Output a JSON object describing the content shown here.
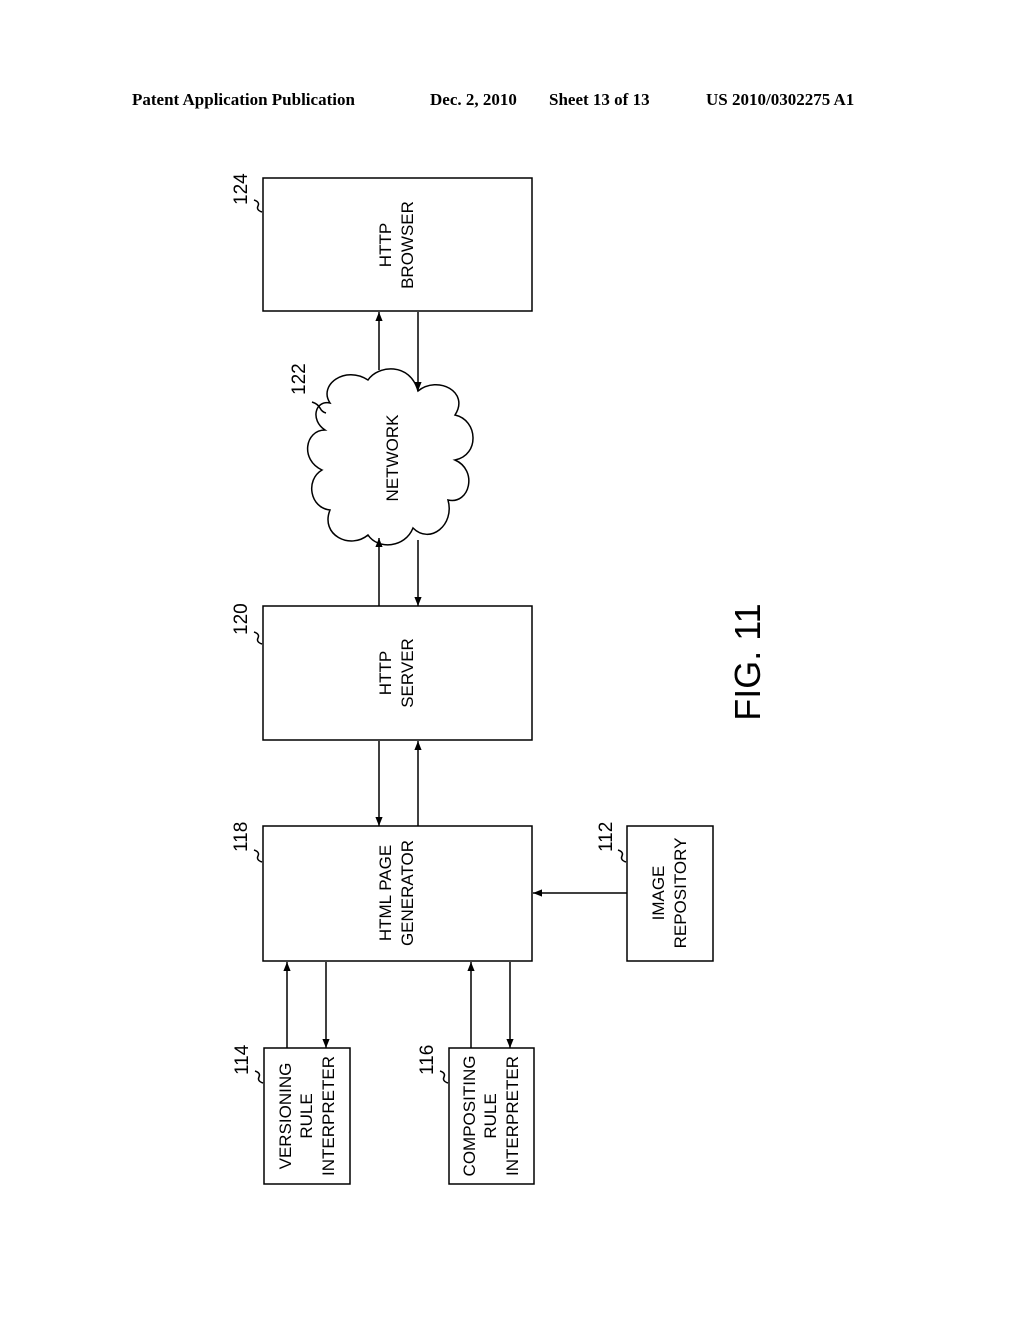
{
  "header": {
    "publication": "Patent Application Publication",
    "date": "Dec. 2, 2010",
    "sheet": "Sheet 13 of 13",
    "number": "US 2010/0302275 A1"
  },
  "figure": {
    "label": "FIG.  11",
    "blocks": [
      {
        "id": "124",
        "lines": [
          "HTTP",
          "BROWSER"
        ]
      },
      {
        "id": "122",
        "lines": [
          "NETWORK"
        ]
      },
      {
        "id": "120",
        "lines": [
          "HTTP",
          "SERVER"
        ]
      },
      {
        "id": "118",
        "lines": [
          "HTML  PAGE",
          "GENERATOR"
        ]
      },
      {
        "id": "112",
        "lines": [
          "IMAGE",
          "REPOSITORY"
        ]
      },
      {
        "id": "114",
        "lines": [
          "VERSIONING",
          "RULE",
          "INTERPRETER"
        ]
      },
      {
        "id": "116",
        "lines": [
          "COMPOSITING",
          "RULE",
          "INTERPRETER"
        ]
      }
    ]
  }
}
